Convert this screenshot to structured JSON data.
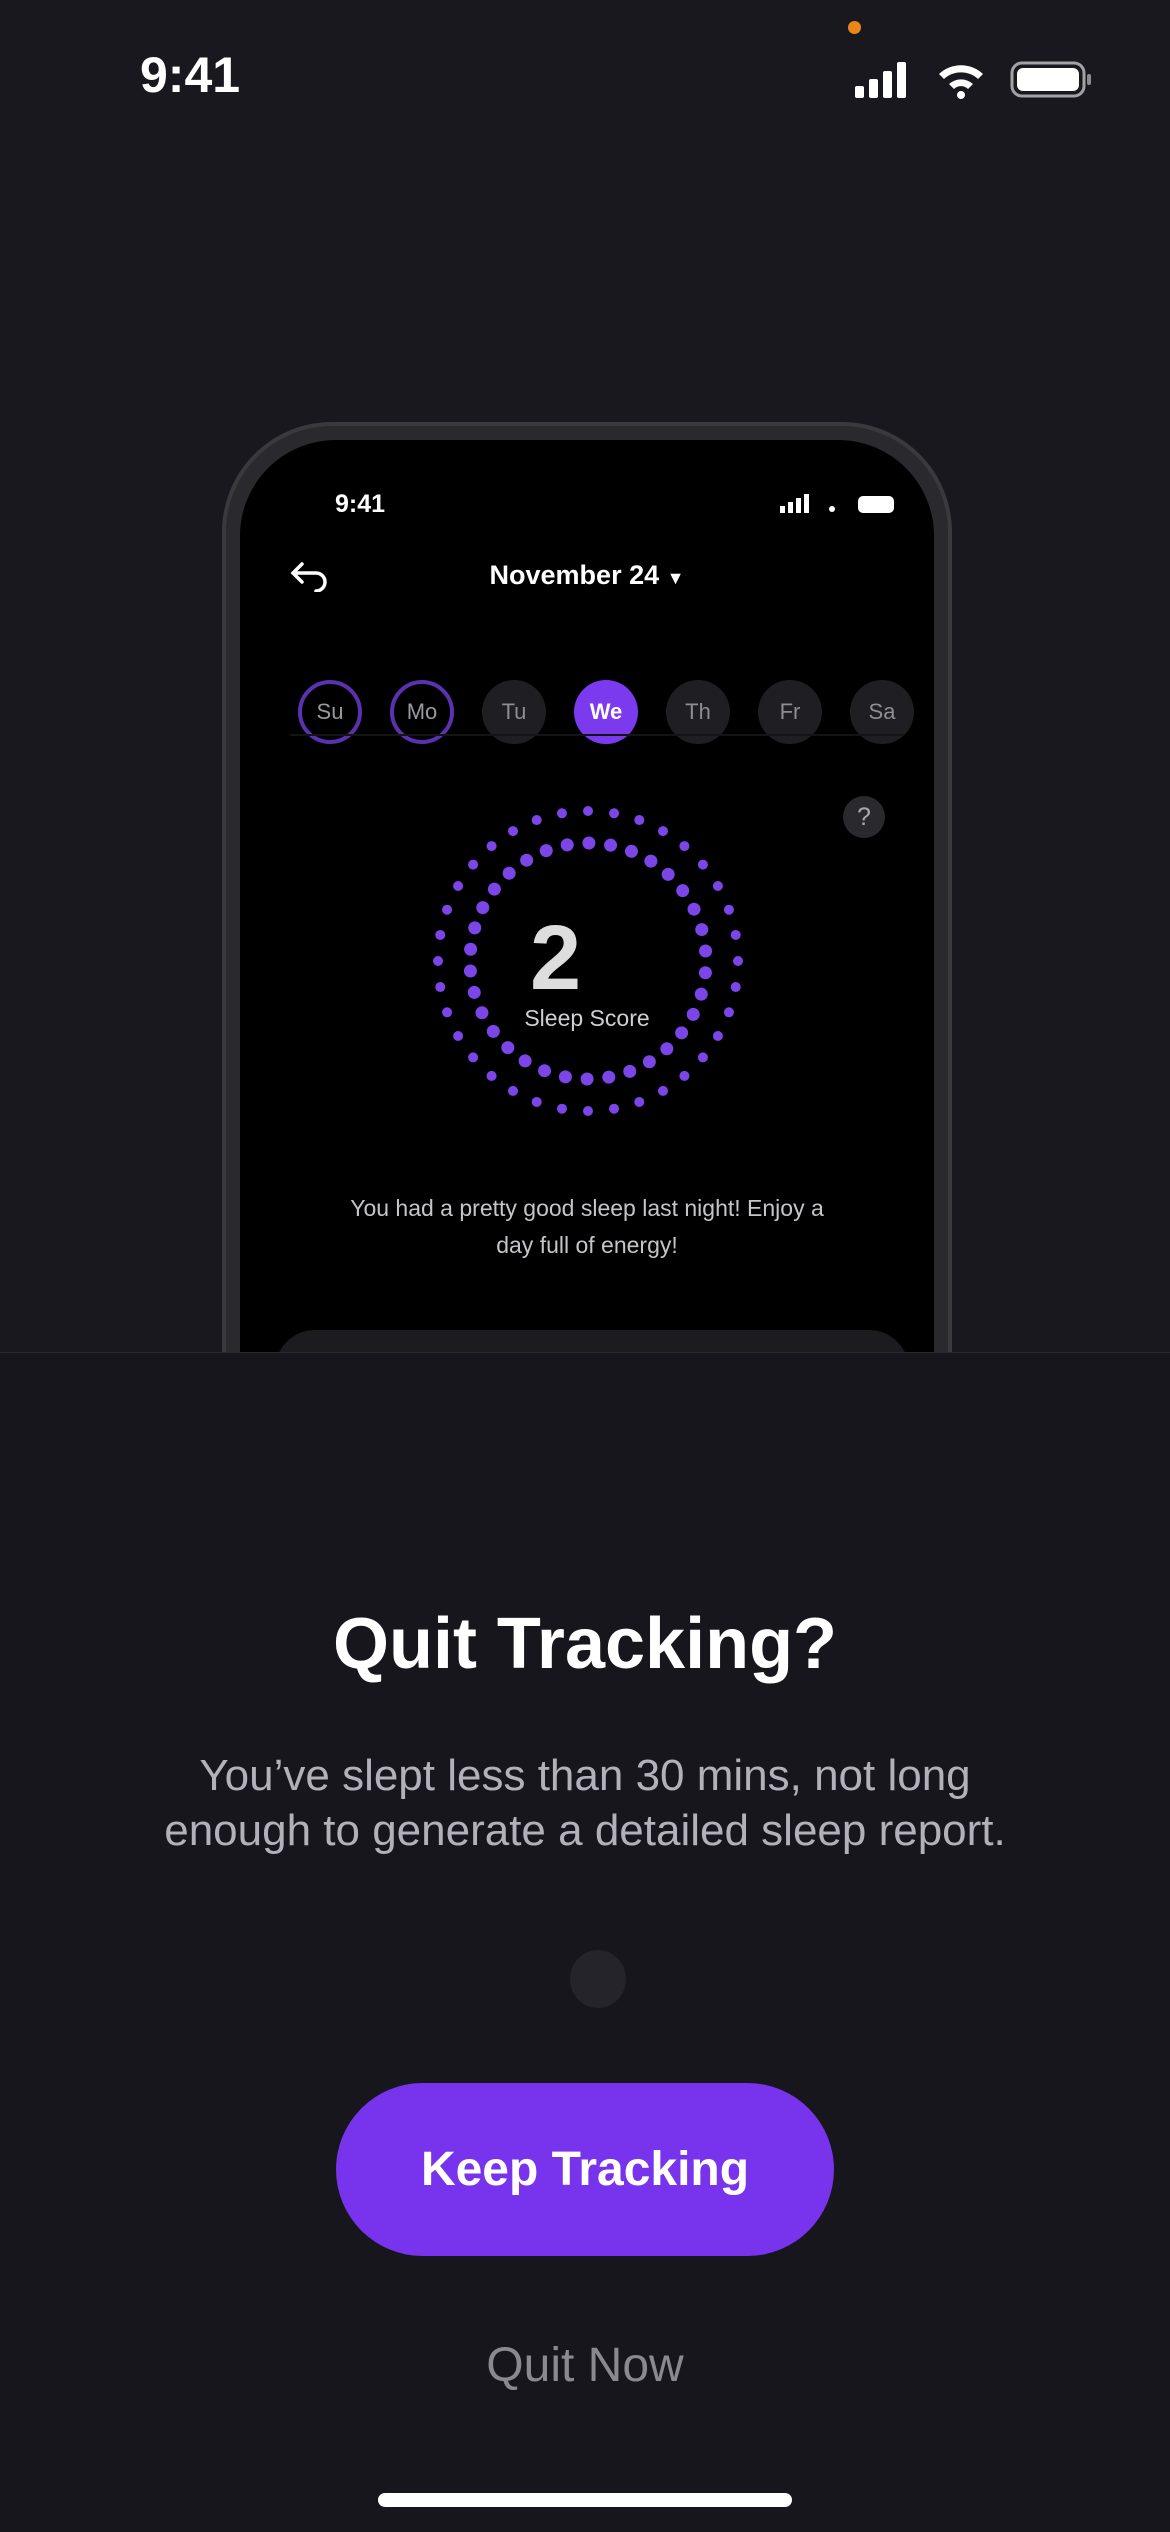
{
  "status_bar": {
    "time": "9:41"
  },
  "phone_preview": {
    "time": "9:41",
    "header_title": "November 24",
    "days": [
      {
        "label": "Su",
        "state": "done"
      },
      {
        "label": "Mo",
        "state": "done"
      },
      {
        "label": "Tu",
        "state": "empty"
      },
      {
        "label": "We",
        "state": "selected"
      },
      {
        "label": "Th",
        "state": "empty"
      },
      {
        "label": "Fr",
        "state": "empty"
      },
      {
        "label": "Sa",
        "state": "empty"
      }
    ],
    "help_label": "?",
    "score_value": "2",
    "score_label": "Sleep Score",
    "message": "You had a pretty good sleep last night! Enjoy a day full of energy!",
    "accent": "#7b3aed"
  },
  "dialog": {
    "title": "Quit Tracking?",
    "body": "You’ve slept less than 30 mins, not long enough to generate a detailed sleep report.",
    "primary_button": "Keep Tracking",
    "secondary_button": "Quit Now",
    "button_color": "#7734ec"
  }
}
